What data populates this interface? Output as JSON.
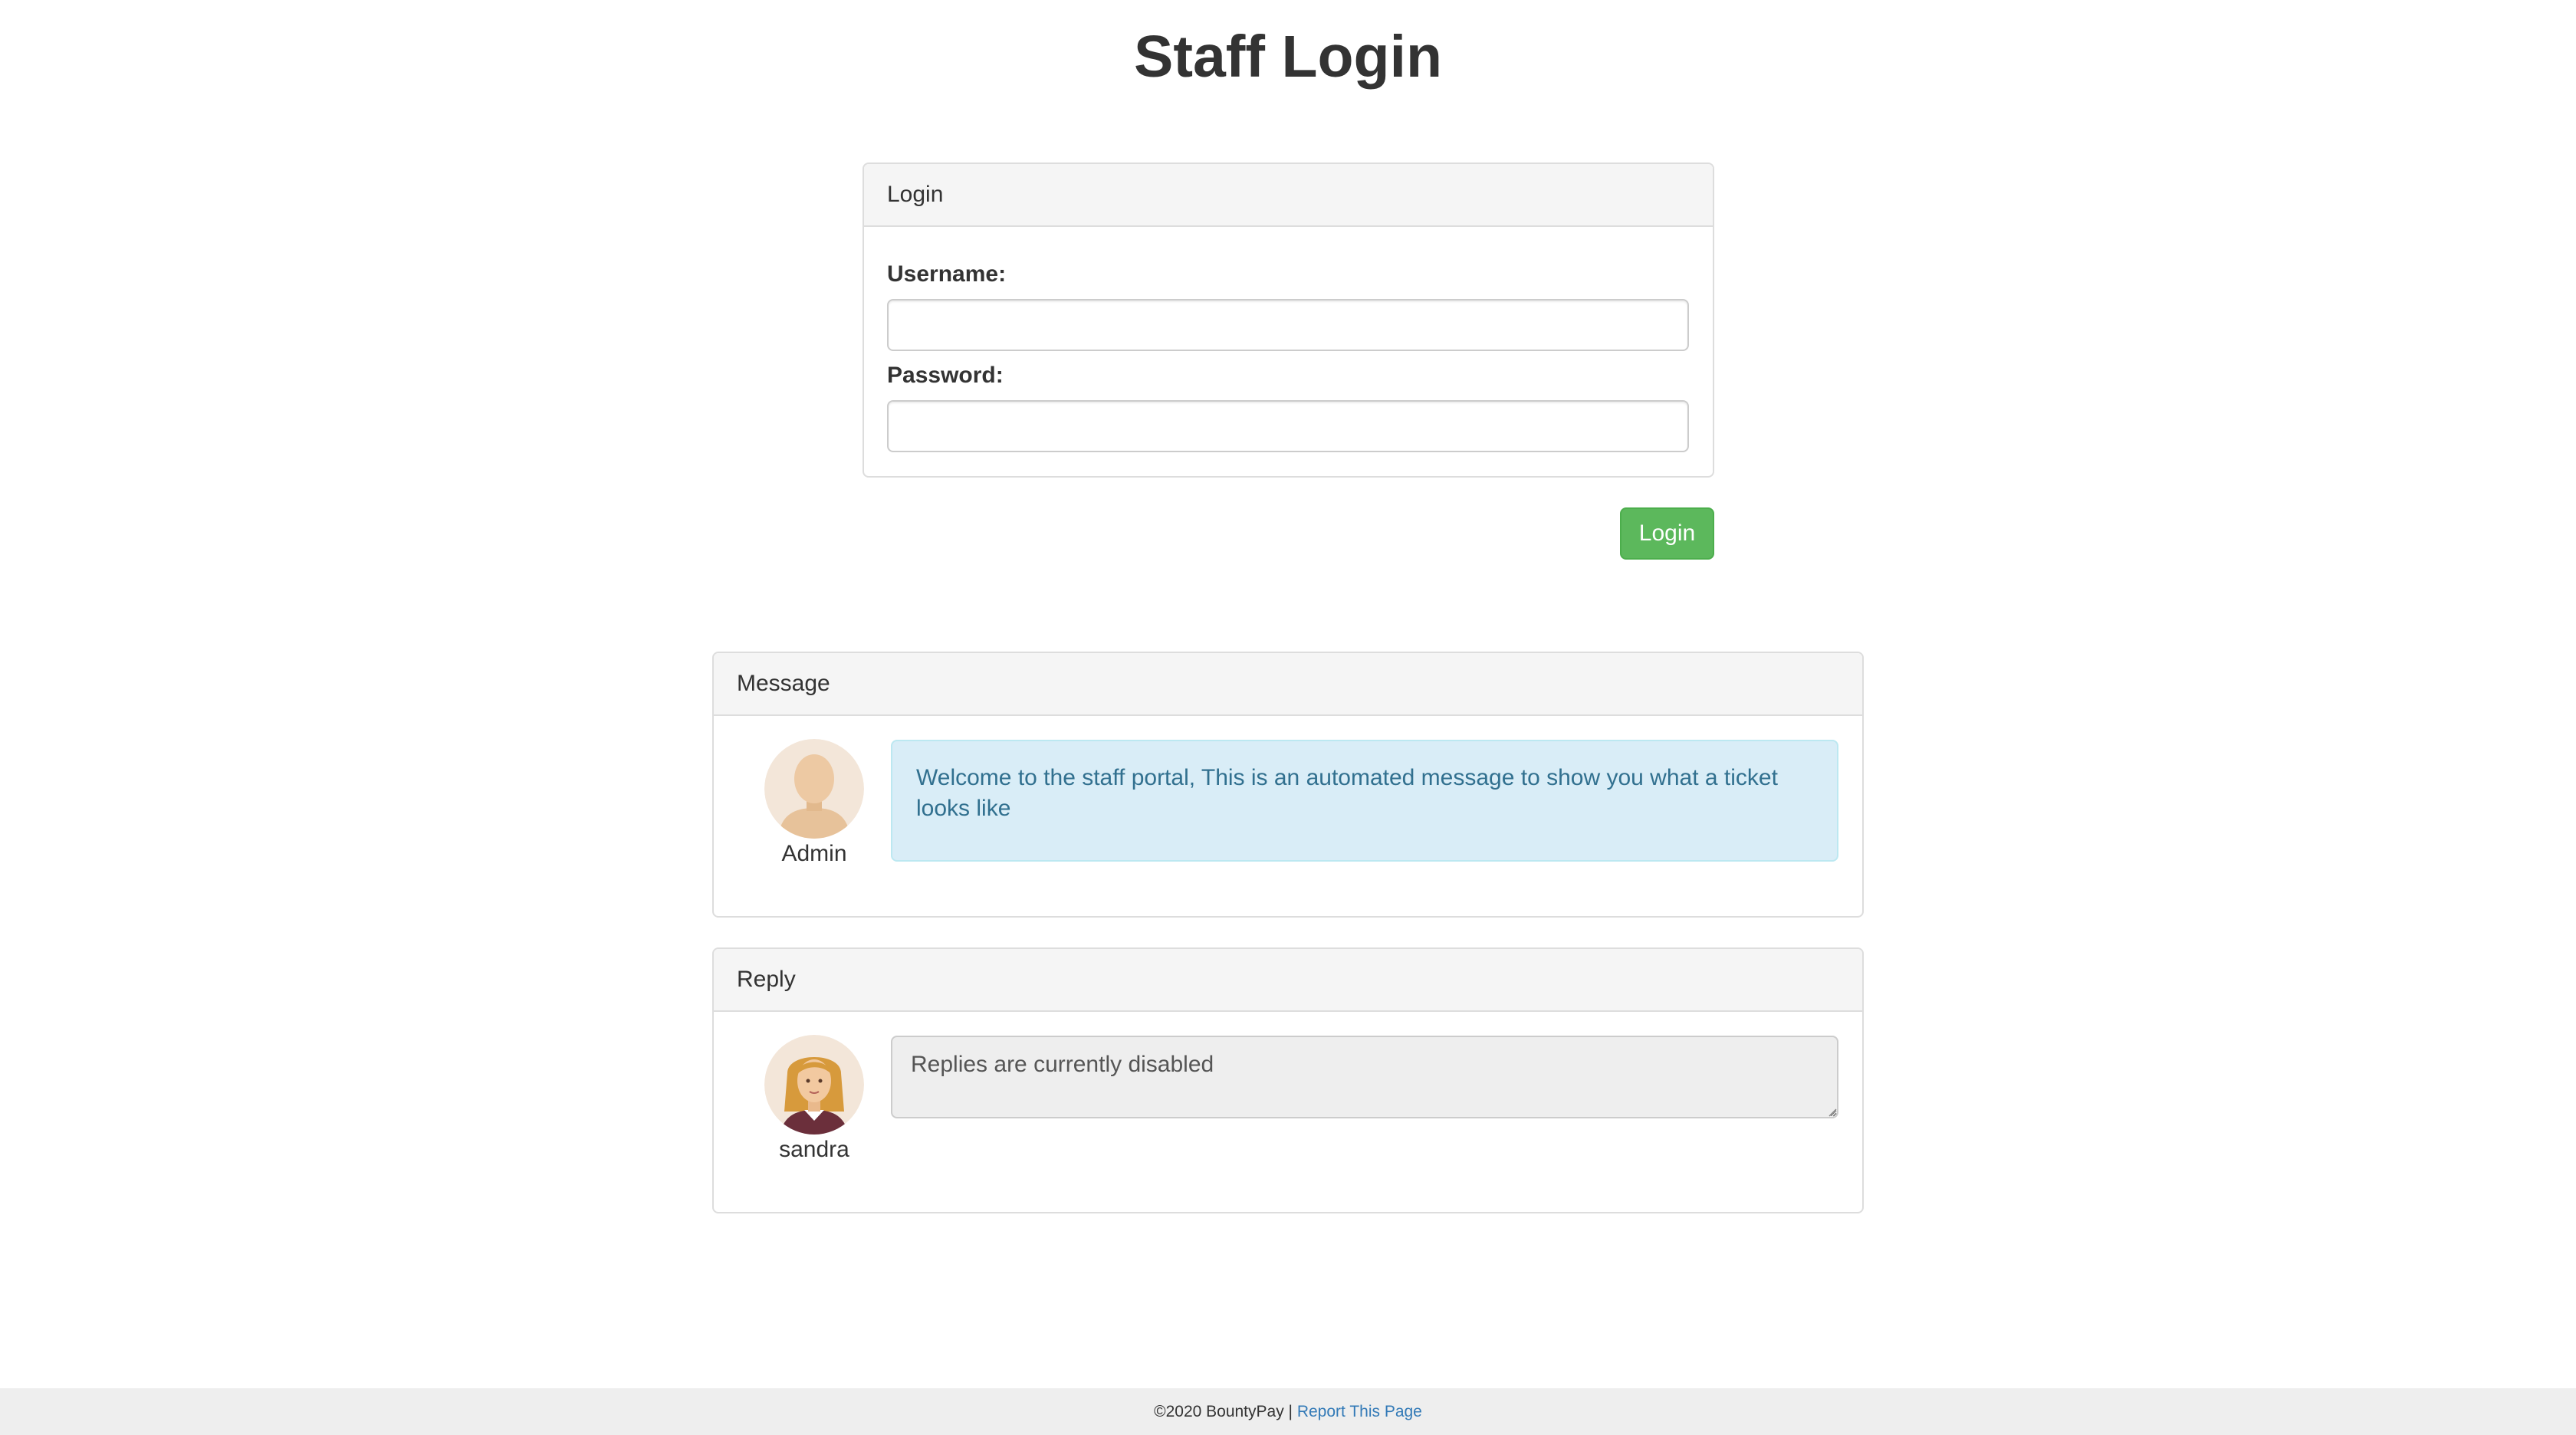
{
  "page": {
    "title": "Staff Login"
  },
  "login_panel": {
    "heading": "Login",
    "username_label": "Username:",
    "username_value": "",
    "password_label": "Password:",
    "password_value": "",
    "submit_label": "Login"
  },
  "message_panel": {
    "heading": "Message",
    "author": "Admin",
    "text": "Welcome to the staff portal, This is an automated message to show you what a ticket looks like"
  },
  "reply_panel": {
    "heading": "Reply",
    "author": "sandra",
    "textarea_value": "Replies are currently disabled"
  },
  "footer": {
    "copyright": "©2020 BountyPay",
    "separator": " | ",
    "report_link": "Report This Page"
  },
  "colors": {
    "login_button": "#5cb85c",
    "message_background": "#d9edf7",
    "message_text": "#31708f",
    "footer_link": "#337ab7"
  },
  "icons": {
    "admin_avatar": "default-user-avatar-icon",
    "sandra_avatar": "female-user-avatar-icon"
  }
}
